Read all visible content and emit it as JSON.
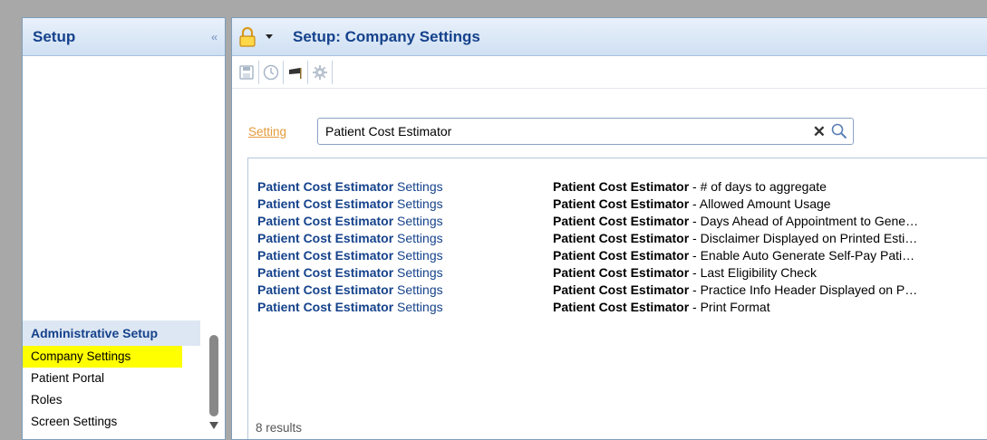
{
  "left_panel": {
    "title": "Setup",
    "collapse_glyph": "‹‹",
    "admin_section": {
      "heading": "Administrative Setup",
      "items": [
        {
          "label": "Company Settings",
          "selected": true
        },
        {
          "label": "Patient Portal",
          "selected": false
        },
        {
          "label": "Roles",
          "selected": false
        },
        {
          "label": "Screen Settings",
          "selected": false
        }
      ]
    }
  },
  "right_panel": {
    "title": "Setup: Company Settings",
    "toolbar_icons": [
      "save-icon",
      "clock-icon",
      "flag-icon",
      "gear-icon"
    ],
    "search": {
      "label": "Setting",
      "value": "Patient Cost Estimator",
      "clear_glyph": "✕"
    },
    "results": [
      {
        "category_bold": "Patient Cost Estimator",
        "category_rest": " Settings",
        "name_bold": "Patient Cost Estimator",
        "name_rest": " - # of days to aggregate"
      },
      {
        "category_bold": "Patient Cost Estimator",
        "category_rest": " Settings",
        "name_bold": "Patient Cost Estimator",
        "name_rest": " - Allowed Amount Usage"
      },
      {
        "category_bold": "Patient Cost Estimator",
        "category_rest": " Settings",
        "name_bold": "Patient Cost Estimator",
        "name_rest": " - Days Ahead of Appointment to Gene…"
      },
      {
        "category_bold": "Patient Cost Estimator",
        "category_rest": " Settings",
        "name_bold": "Patient Cost Estimator",
        "name_rest": " - Disclaimer Displayed on Printed Esti…"
      },
      {
        "category_bold": "Patient Cost Estimator",
        "category_rest": " Settings",
        "name_bold": "Patient Cost Estimator",
        "name_rest": " - Enable Auto Generate Self-Pay Pati…"
      },
      {
        "category_bold": "Patient Cost Estimator",
        "category_rest": " Settings",
        "name_bold": "Patient Cost Estimator",
        "name_rest": " - Last Eligibility Check"
      },
      {
        "category_bold": "Patient Cost Estimator",
        "category_rest": " Settings",
        "name_bold": "Patient Cost Estimator",
        "name_rest": " - Practice Info Header Displayed on P…"
      },
      {
        "category_bold": "Patient Cost Estimator",
        "category_rest": " Settings",
        "name_bold": "Patient Cost Estimator",
        "name_rest": " - Print Format"
      }
    ],
    "result_count": "8 results"
  },
  "colors": {
    "header_text": "#15428b",
    "selected_bg": "#ffff00",
    "setting_link": "#e59a3c"
  }
}
